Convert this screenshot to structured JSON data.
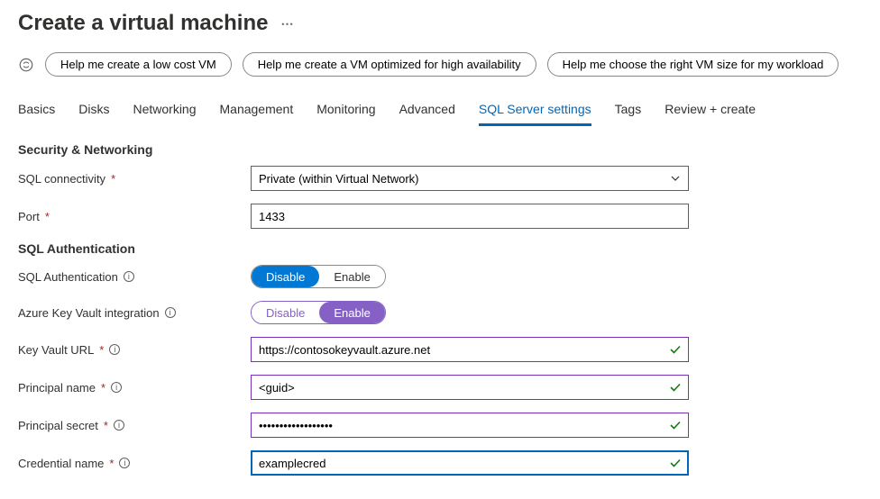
{
  "page": {
    "title": "Create a virtual machine"
  },
  "suggestions": {
    "s1": "Help me create a low cost VM",
    "s2": "Help me create a VM optimized for high availability",
    "s3": "Help me choose the right VM size for my workload"
  },
  "tabs": {
    "basics": "Basics",
    "disks": "Disks",
    "networking": "Networking",
    "management": "Management",
    "monitoring": "Monitoring",
    "advanced": "Advanced",
    "sql": "SQL Server settings",
    "tags": "Tags",
    "review": "Review + create"
  },
  "sections": {
    "security": "Security & Networking",
    "auth": "SQL Authentication"
  },
  "labels": {
    "connectivity": "SQL connectivity",
    "port": "Port",
    "sqlauth": "SQL Authentication",
    "akv": "Azure Key Vault integration",
    "kvurl": "Key Vault URL",
    "pname": "Principal name",
    "psecret": "Principal secret",
    "credname": "Credential name"
  },
  "values": {
    "connectivity_selected": "Private (within Virtual Network)",
    "port": "1433",
    "kvurl": "https://contosokeyvault.azure.net",
    "pname": "<guid>",
    "psecret": "••••••••••••••••••",
    "credname": "examplecred"
  },
  "toggle": {
    "disable": "Disable",
    "enable": "Enable"
  }
}
